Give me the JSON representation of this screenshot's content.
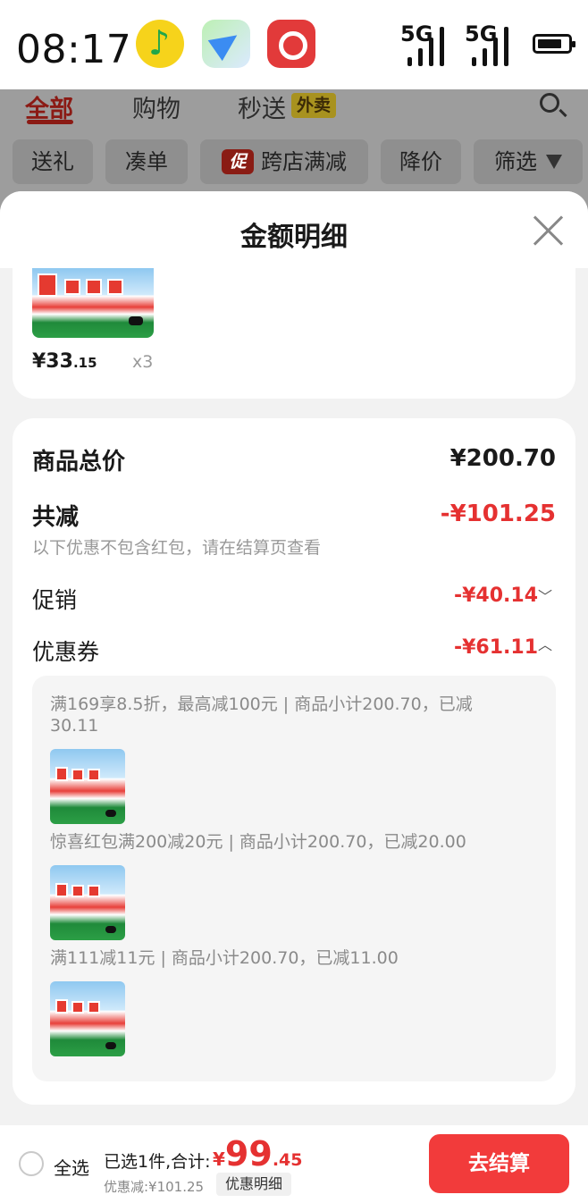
{
  "status_bar": {
    "time": "08:17",
    "network_labels": [
      "5G",
      "5G"
    ],
    "app_icons": [
      "music-app-icon",
      "send-app-icon",
      "netease-music-icon"
    ]
  },
  "background_page": {
    "tabs": [
      "全部",
      "购物",
      "秒送"
    ],
    "takeout_badge": "外卖",
    "chips": [
      "送礼",
      "凑单",
      "跨店满减",
      "降价",
      "筛选"
    ],
    "promo_badge": "促"
  },
  "sheet": {
    "title": "金额明细",
    "item": {
      "price_main": "¥33",
      "price_decimal": ".15",
      "quantity": "x3"
    },
    "summary": {
      "total_label": "商品总价",
      "total_value": "¥200.70",
      "reduce_label": "共减",
      "reduce_value": "-¥101.25",
      "note": "以下优惠不包含红包，请在结算页查看",
      "promo_label": "促销",
      "promo_value": "-¥40.14",
      "coupon_label": "优惠券",
      "coupon_value": "-¥61.11"
    },
    "coupons": [
      {
        "line1": "满169享8.5折，最高减100元 | 商品小计200.70，已减",
        "line2": "30.11"
      },
      {
        "line1": "惊喜红包满200减20元 | 商品小计200.70，已减20.00",
        "line2": ""
      },
      {
        "line1": "满111减11元 | 商品小计200.70，已减11.00",
        "line2": ""
      }
    ]
  },
  "bottom_bar": {
    "select_all": "全选",
    "selected_info": "已选1件,合计:",
    "total_currency": "¥",
    "total_main": "99",
    "total_decimal": ".45",
    "discount_info": "优惠减:¥101.25",
    "detail_button": "优惠明细",
    "checkout_button": "去结算"
  },
  "colors": {
    "accent_red": "#e53131",
    "checkout_red": "#f23b3b",
    "dim_overlay": "#9d9d9d"
  }
}
